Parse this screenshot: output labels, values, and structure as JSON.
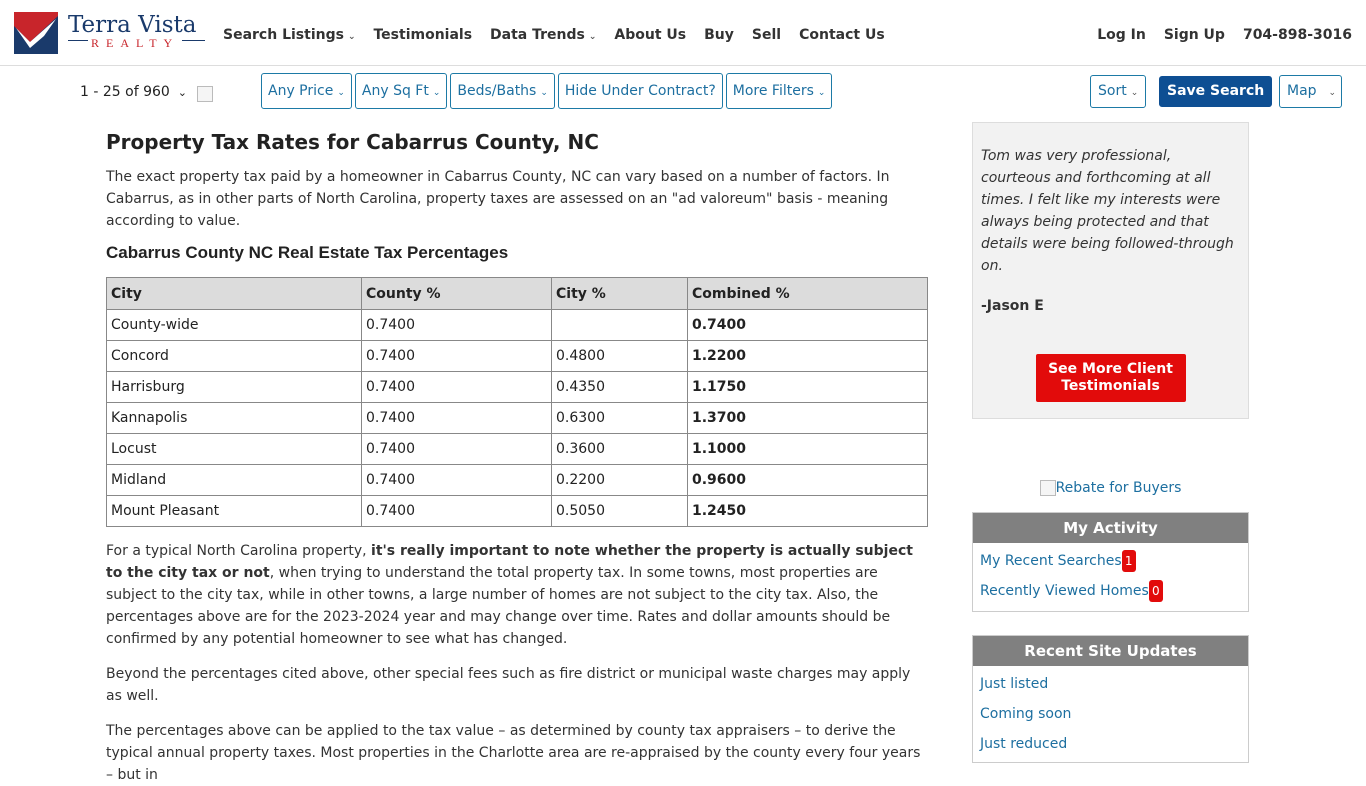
{
  "logo": {
    "name": "Terra Vista",
    "sub": "REALTY"
  },
  "nav": {
    "items": [
      {
        "label": "Search Listings",
        "dropdown": true
      },
      {
        "label": "Testimonials",
        "dropdown": false
      },
      {
        "label": "Data Trends",
        "dropdown": true
      },
      {
        "label": "About Us",
        "dropdown": false
      },
      {
        "label": "Buy",
        "dropdown": false
      },
      {
        "label": "Sell",
        "dropdown": false
      },
      {
        "label": "Contact Us",
        "dropdown": false
      }
    ],
    "login": "Log In",
    "signup": "Sign Up",
    "phone": "704-898-3016",
    "caret": "⌄"
  },
  "toolbar": {
    "count": "1 - 25 of 960",
    "filters": [
      "Any Price",
      "Any Sq Ft",
      "Beds/Baths",
      "Hide Under Contract?",
      "More Filters"
    ],
    "sort": "Sort",
    "save": "Save Search",
    "map": "Map",
    "caret": "⌄"
  },
  "article": {
    "title": "Property Tax Rates for Cabarrus County, NC",
    "intro": "The exact property tax paid by a homeowner in Cabarrus County, NC can vary based on a number of factors. In Cabarrus, as in other parts of North Carolina, property taxes are assessed on an \"ad valoreum\" basis - meaning according to value.",
    "table_title": "Cabarrus County NC Real Estate Tax Percentages",
    "table": {
      "headers": [
        "City",
        "County %",
        "City %",
        "Combined %"
      ],
      "rows": [
        [
          "County-wide",
          "0.7400",
          "",
          "0.7400"
        ],
        [
          "Concord",
          "0.7400",
          "0.4800",
          "1.2200"
        ],
        [
          "Harrisburg",
          "0.7400",
          "0.4350",
          "1.1750"
        ],
        [
          "Kannapolis",
          "0.7400",
          "0.6300",
          "1.3700"
        ],
        [
          "Locust",
          "0.7400",
          "0.3600",
          "1.1000"
        ],
        [
          "Midland",
          "0.7400",
          "0.2200",
          "0.9600"
        ],
        [
          "Mount Pleasant",
          "0.7400",
          "0.5050",
          "1.2450"
        ]
      ]
    },
    "p2_pre": "For a typical North Carolina property, ",
    "p2_bold": "it's really important to note whether the property is actually subject to the city tax or not",
    "p2_post": ", when trying to understand the total property tax. In some towns, most properties are subject to the city tax, while in other towns, a large number of homes are not subject to the city tax. Also, the percentages above are for the 2023-2024 year and may change over time. Rates and dollar amounts should be confirmed by any potential homeowner to see what has changed.",
    "p3": "Beyond the percentages cited above, other special fees such as fire district or municipal waste charges may apply as well.",
    "p4": "The percentages above can be applied to the tax value – as determined by county tax appraisers – to derive the typical annual property taxes. Most properties in the Charlotte area are re-appraised by the county every four years – but in"
  },
  "sidebar": {
    "testimonial": "Tom was very professional, courteous and forthcoming at all times. I felt like my interests were always being protected and that details were being followed-through on.",
    "author": "-Jason E",
    "more_button": "See More Client Testimonials",
    "rebate": "Rebate for Buyers",
    "activity": {
      "title": "My Activity",
      "recent_searches": "My Recent Searches",
      "recent_searches_count": "1",
      "recently_viewed": "Recently Viewed Homes",
      "recently_viewed_count": "0"
    },
    "updates": {
      "title": "Recent Site Updates",
      "items": [
        "Just listed",
        "Coming soon",
        "Just reduced"
      ]
    }
  },
  "colors": {
    "brand_blue": "#1a3a6b",
    "brand_red": "#c8252b",
    "link": "#1d6fa0",
    "save_button": "#0e4f93",
    "cta_red": "#e20b0b"
  }
}
